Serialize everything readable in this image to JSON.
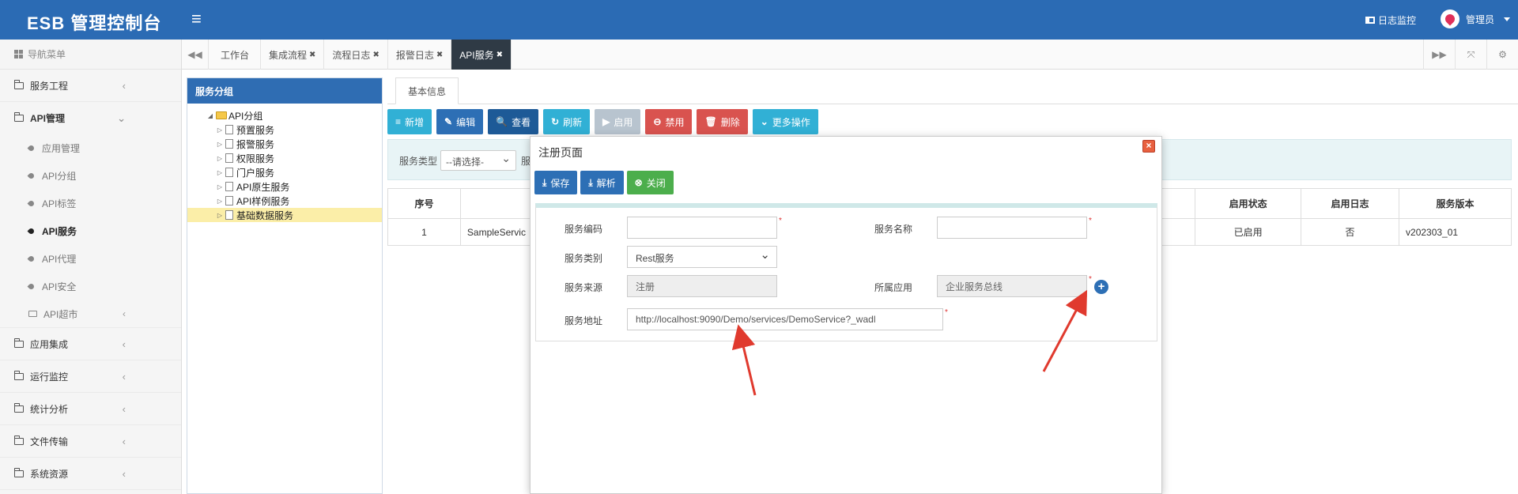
{
  "header": {
    "brand": "ESB 管理控制台",
    "menu_icon": "≡",
    "log_monitor": "日志监控",
    "user_name": "管理员"
  },
  "sidebar": {
    "nav_title": "导航菜单",
    "items": [
      {
        "label": "服务工程",
        "chevron": "‹"
      },
      {
        "label": "API管理",
        "chevron": "⌄"
      }
    ],
    "sub_items": [
      {
        "label": "应用管理"
      },
      {
        "label": "API分组"
      },
      {
        "label": "API标签"
      },
      {
        "label": "API服务"
      },
      {
        "label": "API代理"
      },
      {
        "label": "API安全"
      },
      {
        "label": "API超市",
        "chevron": "‹"
      }
    ],
    "bottom_items": [
      {
        "label": "应用集成",
        "chevron": "‹"
      },
      {
        "label": "运行监控",
        "chevron": "‹"
      },
      {
        "label": "统计分析",
        "chevron": "‹"
      },
      {
        "label": "文件传输",
        "chevron": "‹"
      },
      {
        "label": "系统资源",
        "chevron": "‹"
      }
    ]
  },
  "tabbar": {
    "left_btn": "◀◀",
    "tabs": [
      {
        "label": "工作台",
        "close": ""
      },
      {
        "label": "集成流程",
        "close": "✖"
      },
      {
        "label": "流程日志",
        "close": "✖"
      },
      {
        "label": "报警日志",
        "close": "✖"
      },
      {
        "label": "API服务",
        "close": "✖"
      }
    ],
    "forward_btn": "▶▶",
    "fullscreen_btn": "⤧",
    "settings_btn": "⚙"
  },
  "tree": {
    "title": "服务分组",
    "root": "API分组",
    "root_arrow": "◢",
    "child_arrow": "▷",
    "children": [
      "预置服务",
      "报警服务",
      "权限服务",
      "门户服务",
      "API原生服务",
      "API样例服务",
      "基础数据服务"
    ]
  },
  "content": {
    "inner_tab": "基本信息",
    "toolbar": [
      {
        "label": "新增",
        "icon": "≡"
      },
      {
        "label": "编辑",
        "icon": "✎"
      },
      {
        "label": "查看",
        "icon": "🔍"
      },
      {
        "label": "刷新",
        "icon": "↻"
      },
      {
        "label": "启用",
        "icon": "▶"
      },
      {
        "label": "禁用",
        "icon": "⊖"
      },
      {
        "label": "删除",
        "icon": "🗑"
      },
      {
        "label": "更多操作",
        "icon": "⌄"
      }
    ],
    "filter": {
      "label": "服务类型",
      "placeholder": "--请选择-",
      "label2": "服"
    },
    "table": {
      "headers": [
        "序号",
        "",
        "启用状态",
        "启用日志",
        "服务版本"
      ],
      "rows": [
        {
          "index": "1",
          "name": "SampleServic",
          "status": "已启用",
          "log": "否",
          "version": "v202303_01"
        }
      ]
    }
  },
  "modal": {
    "title": "注册页面",
    "close": "×",
    "buttons": [
      {
        "label": "保存",
        "icon": "⤓"
      },
      {
        "label": "解析",
        "icon": "⤓"
      },
      {
        "label": "关闭",
        "icon": "⊗"
      }
    ],
    "form": {
      "code_label": "服务编码",
      "code_value": "",
      "name_label": "服务名称",
      "name_value": "",
      "type_label": "服务类别",
      "type_value": "Rest服务",
      "source_label": "服务来源",
      "source_value": "注册",
      "app_label": "所属应用",
      "app_value": "企业服务总线",
      "addr_label": "服务地址",
      "addr_value": "http://localhost:9090/Demo/services/DemoService?_wadl",
      "required_mark": "*",
      "plus": "+"
    }
  },
  "colors": {
    "header": "#2b6bb4",
    "active_tab": "#2f3a45",
    "annotation_arrow": "#e03a2e"
  }
}
